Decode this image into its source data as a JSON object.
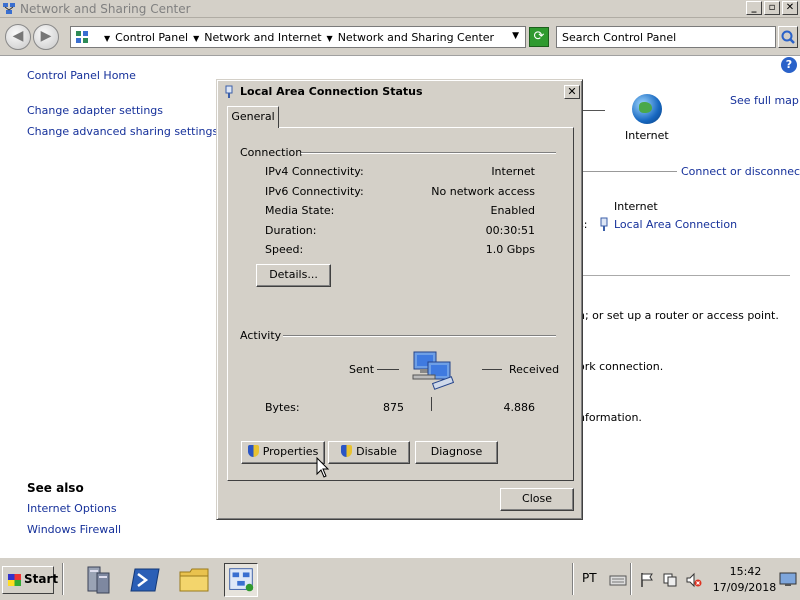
{
  "window": {
    "title": "Network and Sharing Center",
    "controls": {
      "minimize": "_",
      "maximize": "▫",
      "close": "✕"
    }
  },
  "address": {
    "crumbs": [
      "Control Panel",
      "Network and Internet",
      "Network and Sharing Center"
    ],
    "search_placeholder": "Search Control Panel"
  },
  "sidebar": {
    "links": [
      "Control Panel Home",
      "Change adapter settings",
      "Change advanced sharing settings"
    ],
    "see_also_title": "See also",
    "see_also": [
      "Internet Options",
      "Windows Firewall"
    ]
  },
  "background": {
    "internet_label": "Internet",
    "see_full_map": "See full map",
    "connect_or_disconnect": "Connect or disconnect",
    "access_type_value": "Internet",
    "connections_value": "Local Area Connection",
    "fragment_1": ":",
    "fragment_2": "s:",
    "router_text": "n; or set up a router or access point.",
    "network_connection_text": "ork connection.",
    "information_text": "nformation."
  },
  "dialog": {
    "title": "Local Area Connection Status",
    "tab": "General",
    "connection_title": "Connection",
    "rows": [
      {
        "label": "IPv4 Connectivity:",
        "value": "Internet"
      },
      {
        "label": "IPv6 Connectivity:",
        "value": "No network access"
      },
      {
        "label": "Media State:",
        "value": "Enabled"
      },
      {
        "label": "Duration:",
        "value": "00:30:51"
      },
      {
        "label": "Speed:",
        "value": "1.0 Gbps"
      }
    ],
    "details_button": "Details...",
    "activity_title": "Activity",
    "sent_label": "Sent",
    "received_label": "Received",
    "bytes_label": "Bytes:",
    "bytes_sent": "875",
    "bytes_received": "4.886",
    "properties_button": "Properties",
    "disable_button": "Disable",
    "diagnose_button": "Diagnose",
    "close_button": "Close"
  },
  "taskbar": {
    "start_label": "Start",
    "language": "PT",
    "time": "15:42",
    "date": "17/09/2018"
  }
}
